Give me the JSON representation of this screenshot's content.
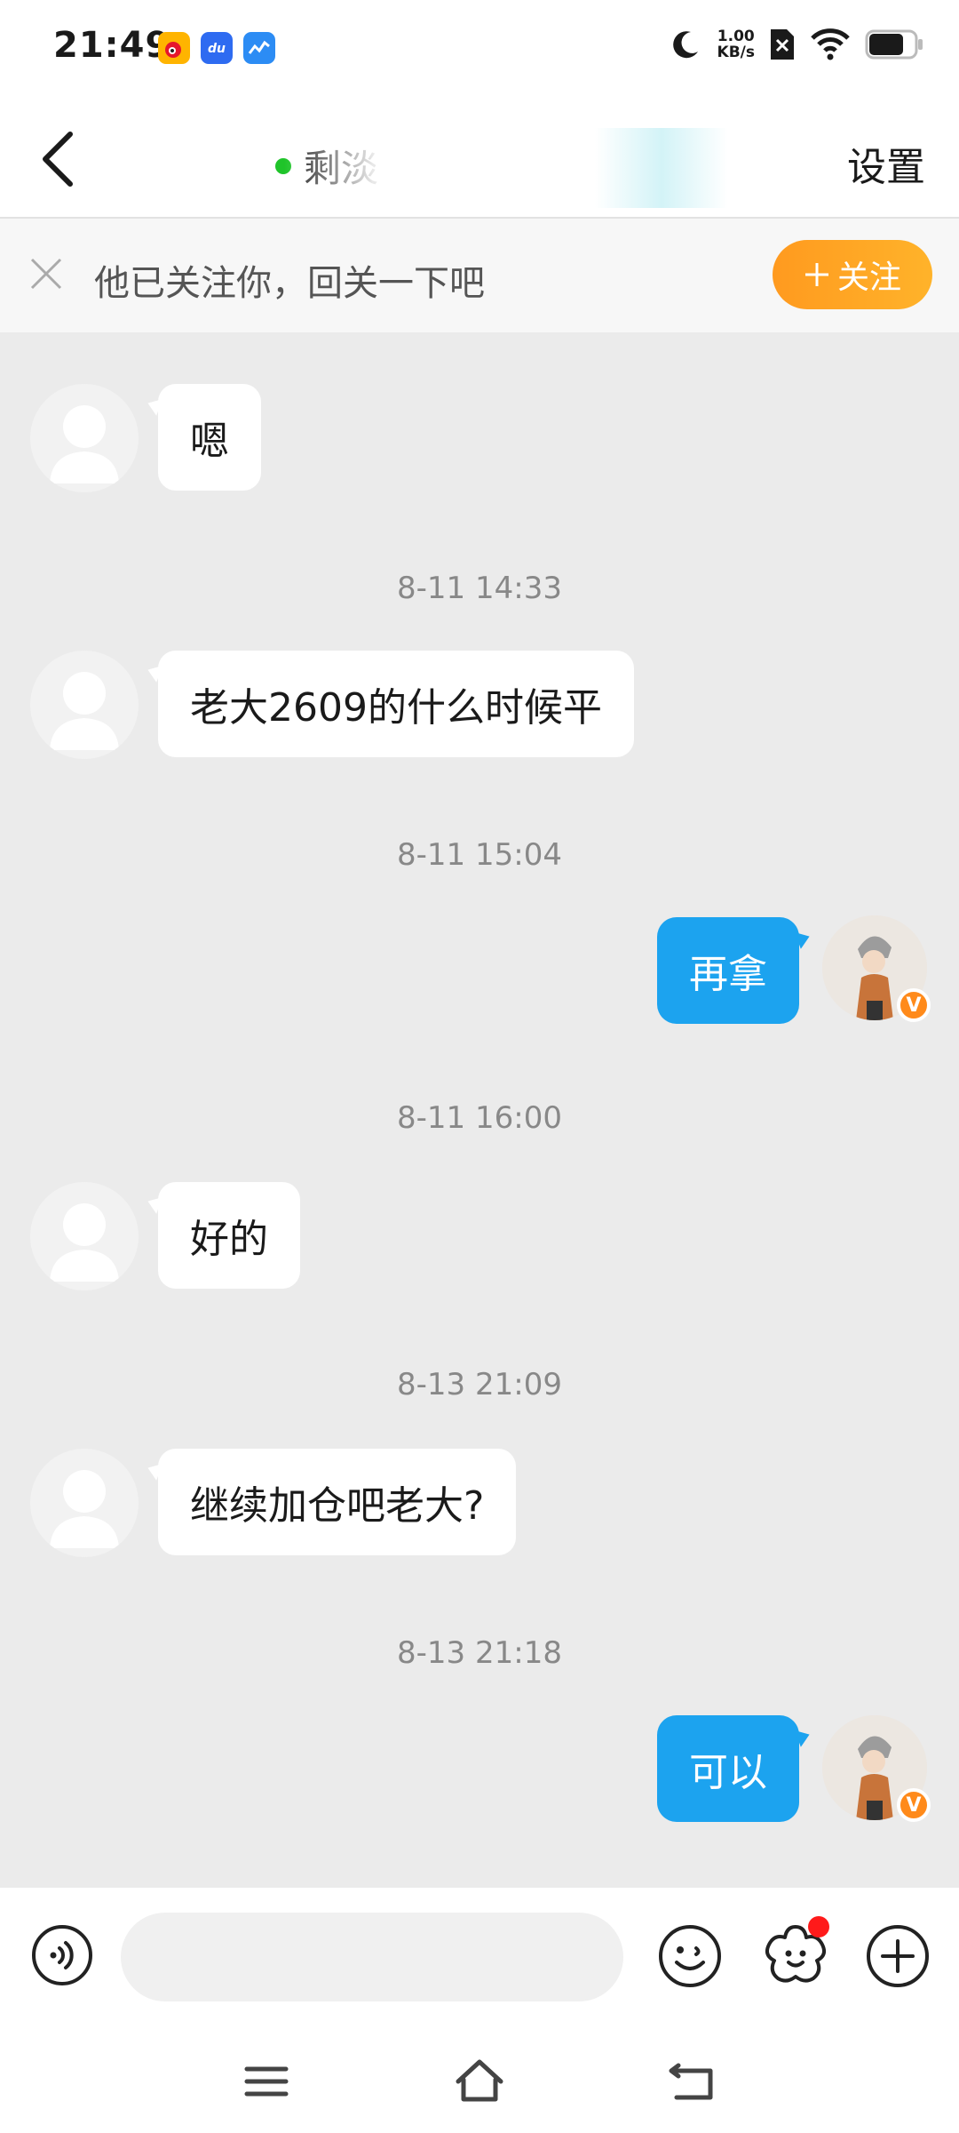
{
  "status_bar": {
    "time": "21:49",
    "net_speed_value": "1.00",
    "net_speed_unit": "KB/s",
    "apps": [
      "weibo-icon",
      "baidu-du-icon",
      "stock-chart-icon"
    ],
    "system_icons": [
      "moon-icon",
      "sim-disabled-icon",
      "wifi-icon",
      "battery-icon"
    ]
  },
  "header": {
    "title": "剩淡",
    "online": true,
    "settings_label": "设置"
  },
  "follow_banner": {
    "text": "他已关注你，回关一下吧",
    "button_label": "关注"
  },
  "messages": [
    {
      "side": "left",
      "text": "嗯"
    },
    {
      "timestamp": "8-11 14:33"
    },
    {
      "side": "left",
      "text": "老大2609的什么时候平"
    },
    {
      "timestamp": "8-11 15:04"
    },
    {
      "side": "right",
      "text": "再拿"
    },
    {
      "timestamp": "8-11 16:00"
    },
    {
      "side": "left",
      "text": "好的"
    },
    {
      "timestamp": "8-13 21:09"
    },
    {
      "side": "left",
      "text": "继续加仓吧老大?"
    },
    {
      "timestamp": "8-13 21:18"
    },
    {
      "side": "right",
      "text": "可以"
    }
  ],
  "input_bar": {
    "placeholder": "",
    "verified_badge": "V"
  },
  "colors": {
    "bubble_outgoing": "#1ca3ef",
    "follow_button": "#ffa21f",
    "online_dot": "#1fc42a",
    "chat_background": "#ebebeb"
  }
}
